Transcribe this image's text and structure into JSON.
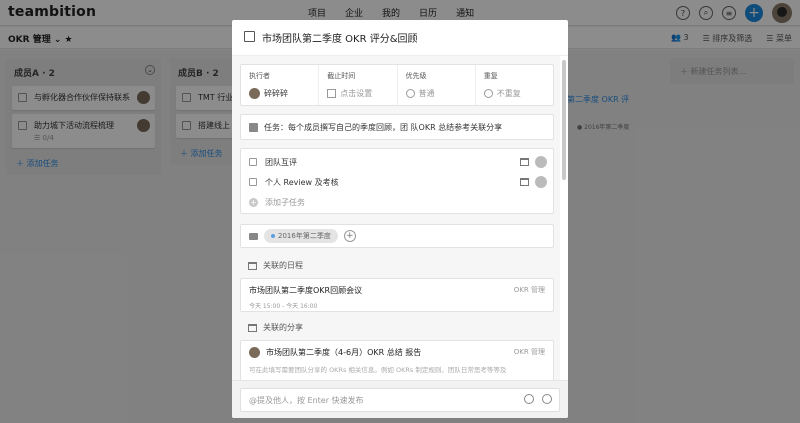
{
  "app": {
    "logo": "teambition"
  },
  "nav": [
    "项目",
    "企业",
    "我的",
    "日历",
    "通知"
  ],
  "top_icons": {
    "help": "?",
    "notice": "≡"
  },
  "project": {
    "title": "OKR 管理",
    "member_count": "3",
    "sort_label": "排序及筛选",
    "menu_label": "菜单"
  },
  "columns": [
    {
      "title": "成员A · 2",
      "cards": [
        {
          "text": "与孵化器合作伙伴保持联系",
          "sub": ""
        },
        {
          "text": "助力城下活动流程梳理",
          "sub": "0/4"
        }
      ],
      "add_task": "添加任务"
    },
    {
      "title": "成员B · 2",
      "cards": [
        {
          "text": "TMT 行业",
          "sub": ""
        },
        {
          "text": "搭建线上",
          "sub": ""
        }
      ],
      "add_task": "添加任务"
    }
  ],
  "col3": {
    "card_text": "第二季度 OKR 评",
    "tag": "2016年第二季度"
  },
  "new_list": "新建任务列表…",
  "modal": {
    "title": "市场团队第二季度 OKR 评分&回顾",
    "meta": {
      "executor_label": "执行者",
      "executor_value": "碎碎碎",
      "deadline_label": "截止时间",
      "deadline_value": "点击设置",
      "priority_label": "优先级",
      "priority_value": "普通",
      "repeat_label": "重复",
      "repeat_value": "不重复"
    },
    "description": "任务：每个成员撰写自己的季度回顾，团 队OKR 总结参考关联分享",
    "subtasks": [
      "团队互评",
      "个人 Review 及考核"
    ],
    "add_subtask": "添加子任务",
    "tag": "2016年第二季度",
    "events_title": "关联的日程",
    "event": {
      "title": "市场团队第二季度OKR回顾会议",
      "time": "今天 15:00 - 今天 16:00",
      "source": "OKR 管理"
    },
    "shares_title": "关联的分享",
    "share": {
      "title": "市场团队第二季度（4-6月）OKR 总结 报告",
      "snippet": "可在此填写需要团队分享的 OKRs 相关信息。例如 OKRs 制定规则、团队日常思考等等及",
      "source": "OKR 管理"
    },
    "comment_placeholder": "@提及他人，按 Enter 快速发布"
  }
}
